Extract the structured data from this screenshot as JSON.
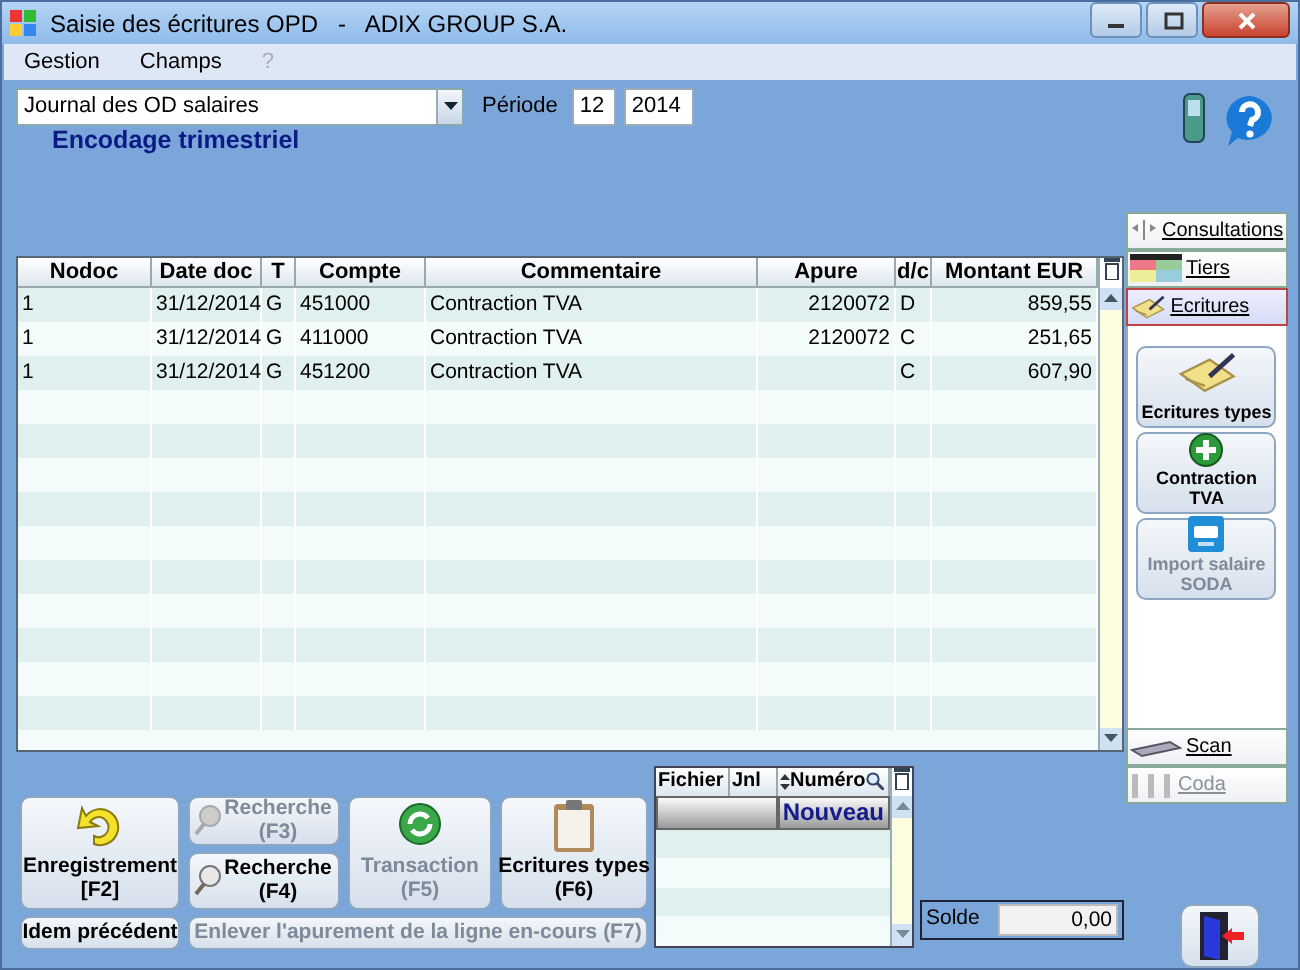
{
  "window": {
    "title": "Saisie des écritures OPD   -   ADIX GROUP S.A."
  },
  "menu": [
    {
      "label": "Gestion",
      "disabled": false
    },
    {
      "label": "Champs",
      "disabled": false
    },
    {
      "label": "?",
      "disabled": true
    }
  ],
  "journal": {
    "value": "Journal des OD salaires"
  },
  "period": {
    "label": "Période",
    "month": "12",
    "year": "2014"
  },
  "mode_title": "Encodage trimestriel",
  "table": {
    "columns": [
      "Nodoc",
      "Date doc",
      "T",
      "Compte",
      "Commentaire",
      "Apure",
      "d/c",
      "Montant EUR"
    ],
    "rows": [
      [
        "1",
        "31/12/2014",
        "G",
        "451000",
        "Contraction TVA",
        "2120072",
        "D",
        "859,55"
      ],
      [
        "1",
        "31/12/2014",
        "G",
        "411000",
        "Contraction TVA",
        "2120072",
        "C",
        "251,65"
      ],
      [
        "1",
        "31/12/2014",
        "G",
        "451200",
        "Contraction TVA",
        "",
        "C",
        "607,90"
      ]
    ]
  },
  "side_panel": {
    "sections": [
      {
        "label": "Consultations",
        "kind": "consult",
        "selected": false
      },
      {
        "label": "Tiers",
        "kind": "grid",
        "selected": false
      },
      {
        "label": "Ecritures",
        "kind": "notepad",
        "selected": true
      }
    ],
    "tools": [
      {
        "label": "Ecritures types",
        "kind": "notepad",
        "disabled": false
      },
      {
        "label": "Contraction TVA",
        "kind": "plus",
        "disabled": false
      },
      {
        "label": "Import salaire SODA",
        "kind": "box",
        "disabled": true
      }
    ],
    "bottom_sections": [
      {
        "label": "Scan",
        "kind": "scanner",
        "disabled": false
      },
      {
        "label": "Coda",
        "kind": "coda",
        "disabled": true
      }
    ]
  },
  "buttons": [
    {
      "label": "Enregistrement",
      "key": "[F2]",
      "kind": "save",
      "disabled": false
    },
    {
      "label": "Recherche",
      "key": "(F3)",
      "kind": "search",
      "disabled": true
    },
    {
      "label": "Recherche",
      "key": "(F4)",
      "kind": "search",
      "disabled": false
    },
    {
      "label": "Transaction",
      "key": "(F5)",
      "kind": "refresh",
      "disabled": true
    },
    {
      "label": "Ecritures types",
      "key": "(F6)",
      "kind": "clipboard",
      "disabled": false
    }
  ],
  "row_buttons": [
    {
      "label": "Idem précédent",
      "disabled": false
    },
    {
      "label": "Enlever l'apurement de la ligne en-cours (F7)",
      "disabled": true
    }
  ],
  "documents": {
    "columns": [
      "Fichier",
      "Jnl",
      "Numéro"
    ],
    "rows": [
      {
        "numero": "Nouveau",
        "selected": true
      }
    ]
  },
  "solde": {
    "label": "Solde",
    "value": "0,00"
  }
}
